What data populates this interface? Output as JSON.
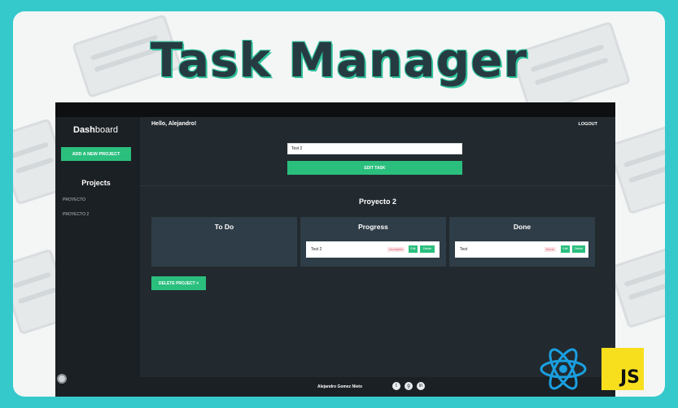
{
  "banner": {
    "title": "Task Manager"
  },
  "sidebar": {
    "brand_bold": "Dash",
    "brand_light": "board",
    "add_project_label": "ADD A NEW PROJECT",
    "projects_heading": "Projects",
    "items": [
      {
        "label": "PROYECTO"
      },
      {
        "label": "PROYECTO 2"
      }
    ]
  },
  "header": {
    "greeting": "Hello, Alejandro!",
    "logout_label": "LOGOUT"
  },
  "task_form": {
    "input_value": "Test 2",
    "edit_button_label": "EDIT TASK"
  },
  "project": {
    "title": "Proyecto 2",
    "columns": [
      {
        "title": "To Do",
        "tasks": []
      },
      {
        "title": "Progress",
        "tasks": [
          {
            "name": "Test 2",
            "status": "Incomplete",
            "edit_label": "Edit",
            "delete_label": "Delete"
          }
        ]
      },
      {
        "title": "Done",
        "tasks": [
          {
            "name": "Test",
            "status": "Borrar",
            "edit_label": "Edit",
            "delete_label": "Delete"
          }
        ]
      }
    ],
    "delete_button_label": "DELETE PROJECT ×"
  },
  "footer": {
    "author": "Alejandro Gomez Nieto",
    "social_icons": [
      "twitter-icon",
      "github-icon",
      "linkedin-icon"
    ]
  },
  "badges": {
    "react": "react-logo-icon",
    "js": "JS"
  },
  "colors": {
    "accent": "#2bbf7e",
    "frame": "#35c9cc",
    "panel": "#2e3d47"
  }
}
